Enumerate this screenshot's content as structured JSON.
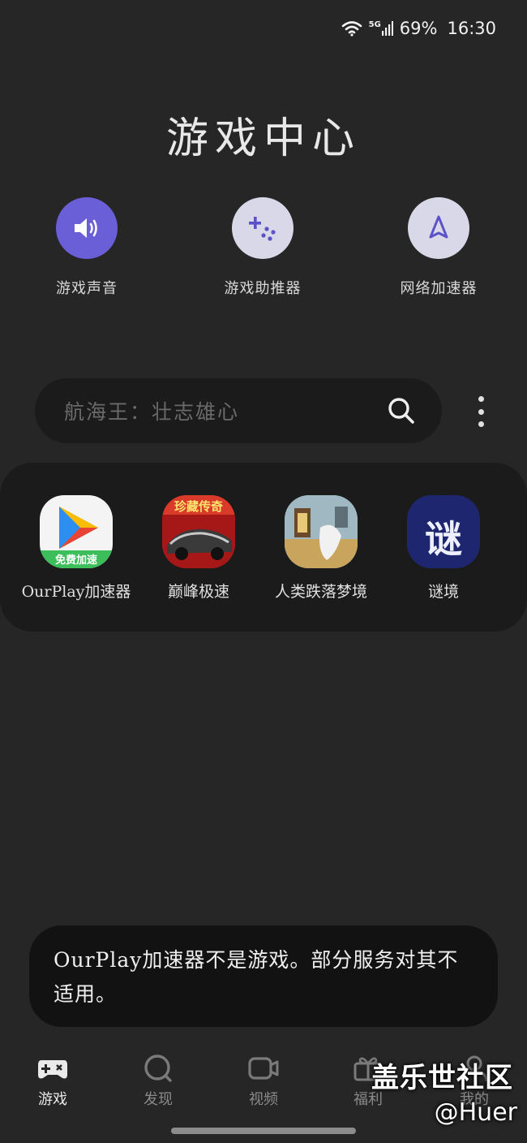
{
  "status_bar": {
    "network": "5G",
    "battery": "69%",
    "time": "16:30"
  },
  "title": "游戏中心",
  "quick_tools": [
    {
      "label": "游戏声音",
      "icon": "speaker-icon",
      "color": "#6a5fd6"
    },
    {
      "label": "游戏助推器",
      "icon": "gamepad-dots-icon",
      "color": "#d8d8e8"
    },
    {
      "label": "网络加速器",
      "icon": "rocket-icon",
      "color": "#d8d8e8"
    }
  ],
  "search": {
    "placeholder": "航海王：壮志雄心",
    "icon": "search-icon"
  },
  "games": [
    {
      "label": "OurPlay加速器",
      "icon": "ourplay-app-icon",
      "badge": "免费加速"
    },
    {
      "label": "巅峰极速",
      "icon": "racing-game-icon",
      "badge": "珍藏传奇"
    },
    {
      "label": "人类跌落梦境",
      "icon": "human-fall-flat-icon"
    },
    {
      "label": "谜境",
      "icon": "mijing-app-icon",
      "badge": "谜"
    }
  ],
  "toast": {
    "message": "OurPlay加速器不是游戏。部分服务对其不适用。"
  },
  "bottom_nav": [
    {
      "label": "游戏",
      "icon": "gamepad-icon",
      "active": true
    },
    {
      "label": "发现",
      "icon": "discover-icon",
      "active": false
    },
    {
      "label": "视频",
      "icon": "video-icon",
      "active": false
    },
    {
      "label": "福利",
      "icon": "gift-icon",
      "active": false
    },
    {
      "label": "我的",
      "icon": "profile-icon",
      "active": false
    }
  ],
  "watermark": {
    "main": "盖乐世社区",
    "sub": "@Huer"
  },
  "colors": {
    "background": "#262626",
    "panel": "#1b1b1b",
    "accent": "#6a5fd6",
    "toast": "#121212"
  }
}
